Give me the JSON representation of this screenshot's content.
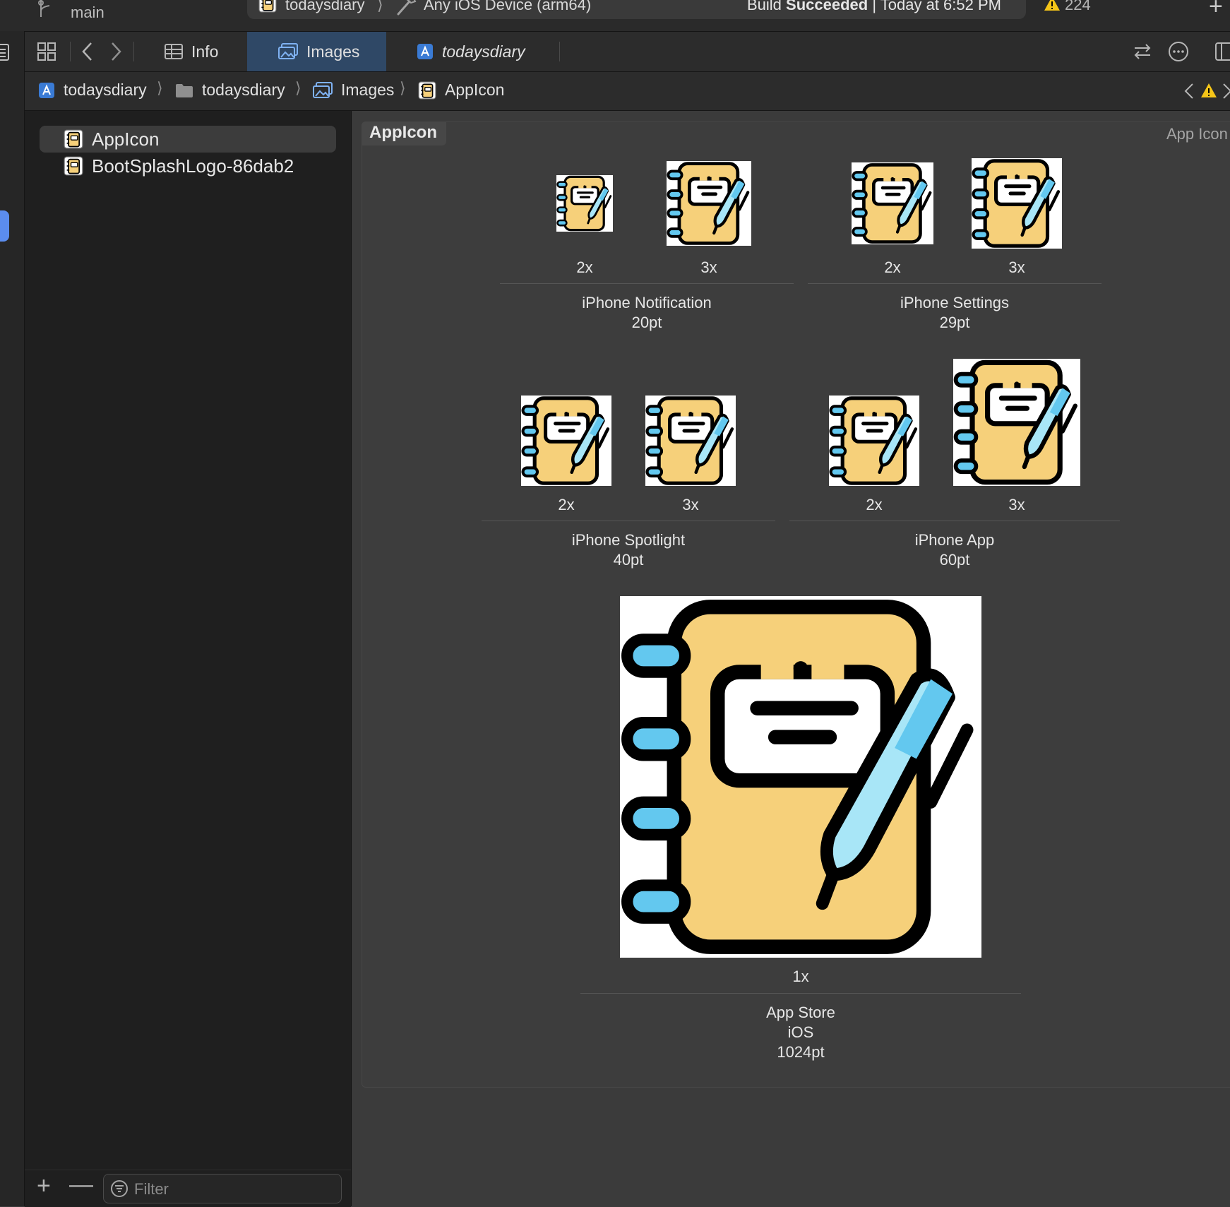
{
  "toolbar": {
    "branch": "main",
    "scheme": "todaysdiary",
    "device": "Any iOS Device (arm64)",
    "build_status_prefix": "Build",
    "build_status_bold": "Succeeded",
    "build_status_suffix": "| Today at 6:52 PM",
    "warning_count": "224"
  },
  "tabs": [
    {
      "label": "Info",
      "icon": "table-icon"
    },
    {
      "label": "Images",
      "icon": "images-icon"
    },
    {
      "label": "todaysdiary",
      "icon": "app-project-icon"
    }
  ],
  "breadcrumb": [
    {
      "label": "todaysdiary",
      "icon": "app-project-icon"
    },
    {
      "label": "todaysdiary",
      "icon": "folder-icon"
    },
    {
      "label": "Images",
      "icon": "images-icon"
    },
    {
      "label": "AppIcon",
      "icon": "appicon-asset-icon"
    }
  ],
  "navigator": {
    "items": [
      {
        "label": "AppIcon",
        "selected": true
      },
      {
        "label": "BootSplashLogo-86dab2",
        "selected": false
      }
    ],
    "filter_placeholder": "Filter"
  },
  "editor": {
    "set_name": "AppIcon",
    "set_type": "App Icon",
    "groups": [
      {
        "name": "iPhone Notification",
        "size": "20pt",
        "scales": [
          "2x",
          "3x"
        ]
      },
      {
        "name": "iPhone Settings",
        "size": "29pt",
        "scales": [
          "2x",
          "3x"
        ]
      },
      {
        "name": "iPhone Spotlight",
        "size": "40pt",
        "scales": [
          "2x",
          "3x"
        ]
      },
      {
        "name": "iPhone App",
        "size": "60pt",
        "scales": [
          "2x",
          "3x"
        ]
      },
      {
        "name": "App Store",
        "platform": "iOS",
        "size": "1024pt",
        "scales": [
          "1x"
        ]
      }
    ]
  },
  "colors": {
    "accent": "#5b8def",
    "selected_tab": "#2f4866",
    "warning": "#f5c518",
    "icon_notebook": "#f6d07a",
    "icon_pen": "#63c8ef"
  }
}
